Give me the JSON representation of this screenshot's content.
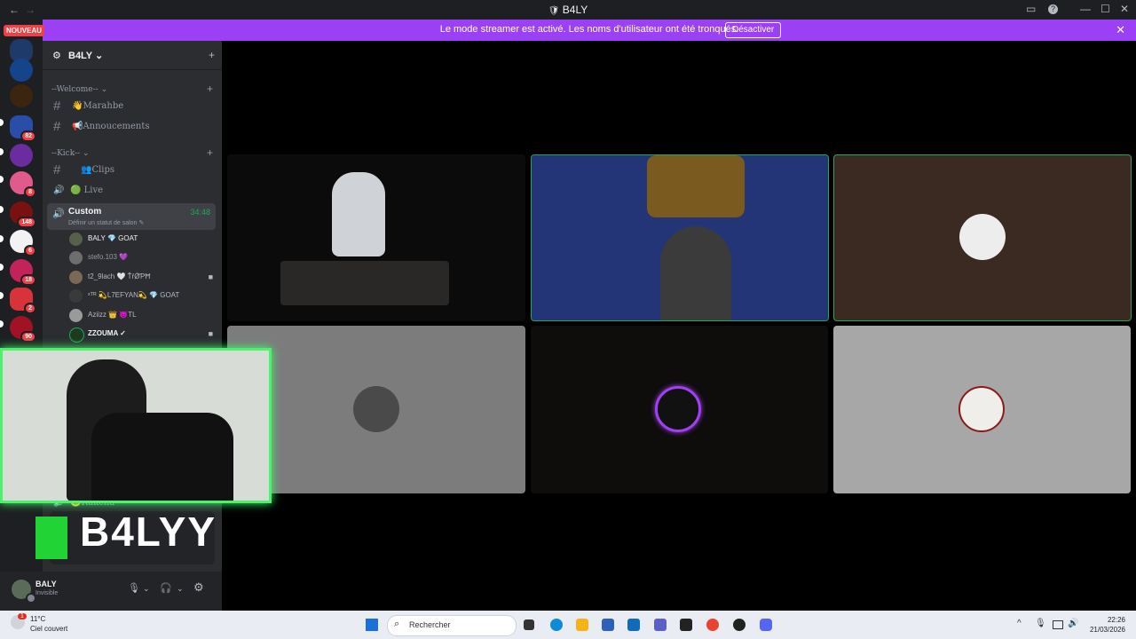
{
  "window": {
    "title": "B4LY",
    "back_glyph": "←",
    "forward_glyph": "→",
    "controls": {
      "inbox": "▭",
      "help": "?",
      "minimize": "—",
      "maximize": "☐",
      "close": "✕"
    }
  },
  "banner": {
    "message": "Le mode streamer est activé. Les noms d'utilisateur ont été tronqués.",
    "button": "Désactiver",
    "close_glyph": "✕"
  },
  "guilds": {
    "new_label": "NOUVEAU",
    "badges": [
      "82",
      "8",
      "148",
      "6",
      "18",
      "2",
      "90"
    ]
  },
  "server": {
    "name": "B4LY",
    "chevron": "⌄",
    "icon": "⚙",
    "add_member_glyph": "+"
  },
  "categories": [
    {
      "label": "--Welcome--",
      "toggle": "⌄",
      "plus": "+"
    },
    {
      "label": "--Kick--",
      "toggle": "⌄",
      "plus": "+"
    }
  ],
  "channels": {
    "marahbe": {
      "label": "👋Marahbe",
      "glyph": "#"
    },
    "annoucements": {
      "label": "📢Annoucements",
      "glyph": "#"
    },
    "clips": {
      "label": "👥Clips",
      "glyph": "#"
    },
    "live": {
      "label": "🟢 Live",
      "glyph": "🔊"
    }
  },
  "voice_channel": {
    "name": "Custom",
    "time": "34:48",
    "status_prompt": "Définir un statut de salon ✎",
    "glyph": "🔊"
  },
  "voice_users": [
    {
      "name": "BALY  💎 GOAT",
      "camera": ""
    },
    {
      "name": "stefo.103 💜",
      "camera": ""
    },
    {
      "name": "t2_9lach  🤍 ŤŕǾƤĦ",
      "camera": "■"
    },
    {
      "name": "ˣᵀᴿ 💫L7EFYAN💫  💎 GOAT",
      "camera": ""
    },
    {
      "name": "Aziizz 👑  😈TL",
      "camera": ""
    },
    {
      "name": "ZZOUMA ✓",
      "camera": "■"
    }
  ],
  "lower_channel": {
    "label": "😊Rakcha",
    "glyph": "🔊"
  },
  "overlay": {
    "brand_text": "B4LYY"
  },
  "user_panel": {
    "name": "BALY",
    "status": "Invisible",
    "mic_glyph": "🎙",
    "headset_glyph": "🎧",
    "settings_glyph": "⚙",
    "chevron": "⌄"
  },
  "taskbar": {
    "weather_badge": "1",
    "temperature": "11°C",
    "condition": "Ciel couvert",
    "search_placeholder": "Rechercher",
    "search_glyph": "⌕",
    "time": "22:26",
    "date": "21/03/2026",
    "tray_chevron": "^",
    "tray_mic": "🎙",
    "tray_speaker": "🔊",
    "app_colors": [
      "#1e6fd9",
      "#0078d4",
      "#f3b415",
      "#2f5fb8",
      "#0f6cbd",
      "#5b5fc7",
      "#333333",
      "#e94235",
      "#222222",
      "#5865f2"
    ]
  },
  "colors": {
    "brand": "#9b40f4",
    "speaking": "#23a55a",
    "webcam_glow": "#4cf269",
    "badge": "#f23f43"
  }
}
